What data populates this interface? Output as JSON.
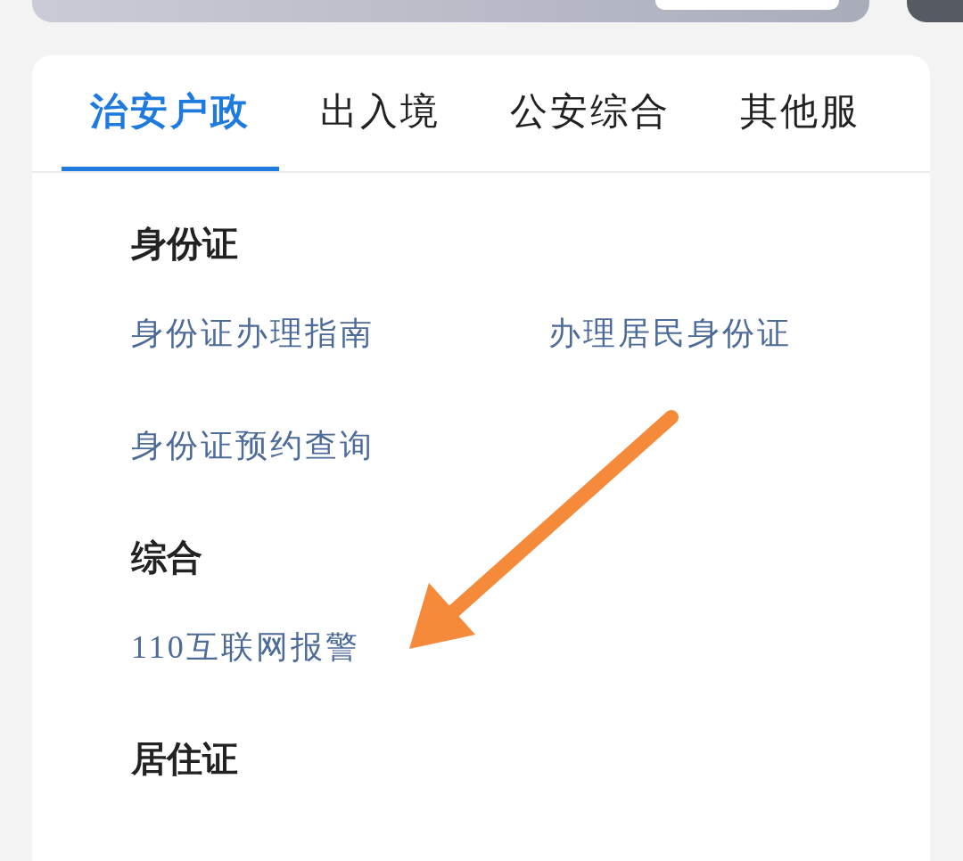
{
  "tabs": [
    {
      "label": "治安户政",
      "selected": true
    },
    {
      "label": "出入境",
      "selected": false
    },
    {
      "label": "公安综合",
      "selected": false
    },
    {
      "label": "其他服",
      "selected": false
    }
  ],
  "sections": [
    {
      "heading": "身份证",
      "links": [
        "身份证办理指南",
        "办理居民身份证",
        "身份证预约查询"
      ]
    },
    {
      "heading": "综合",
      "links": [
        "110互联网报警"
      ]
    },
    {
      "heading": "居住证"
    }
  ]
}
